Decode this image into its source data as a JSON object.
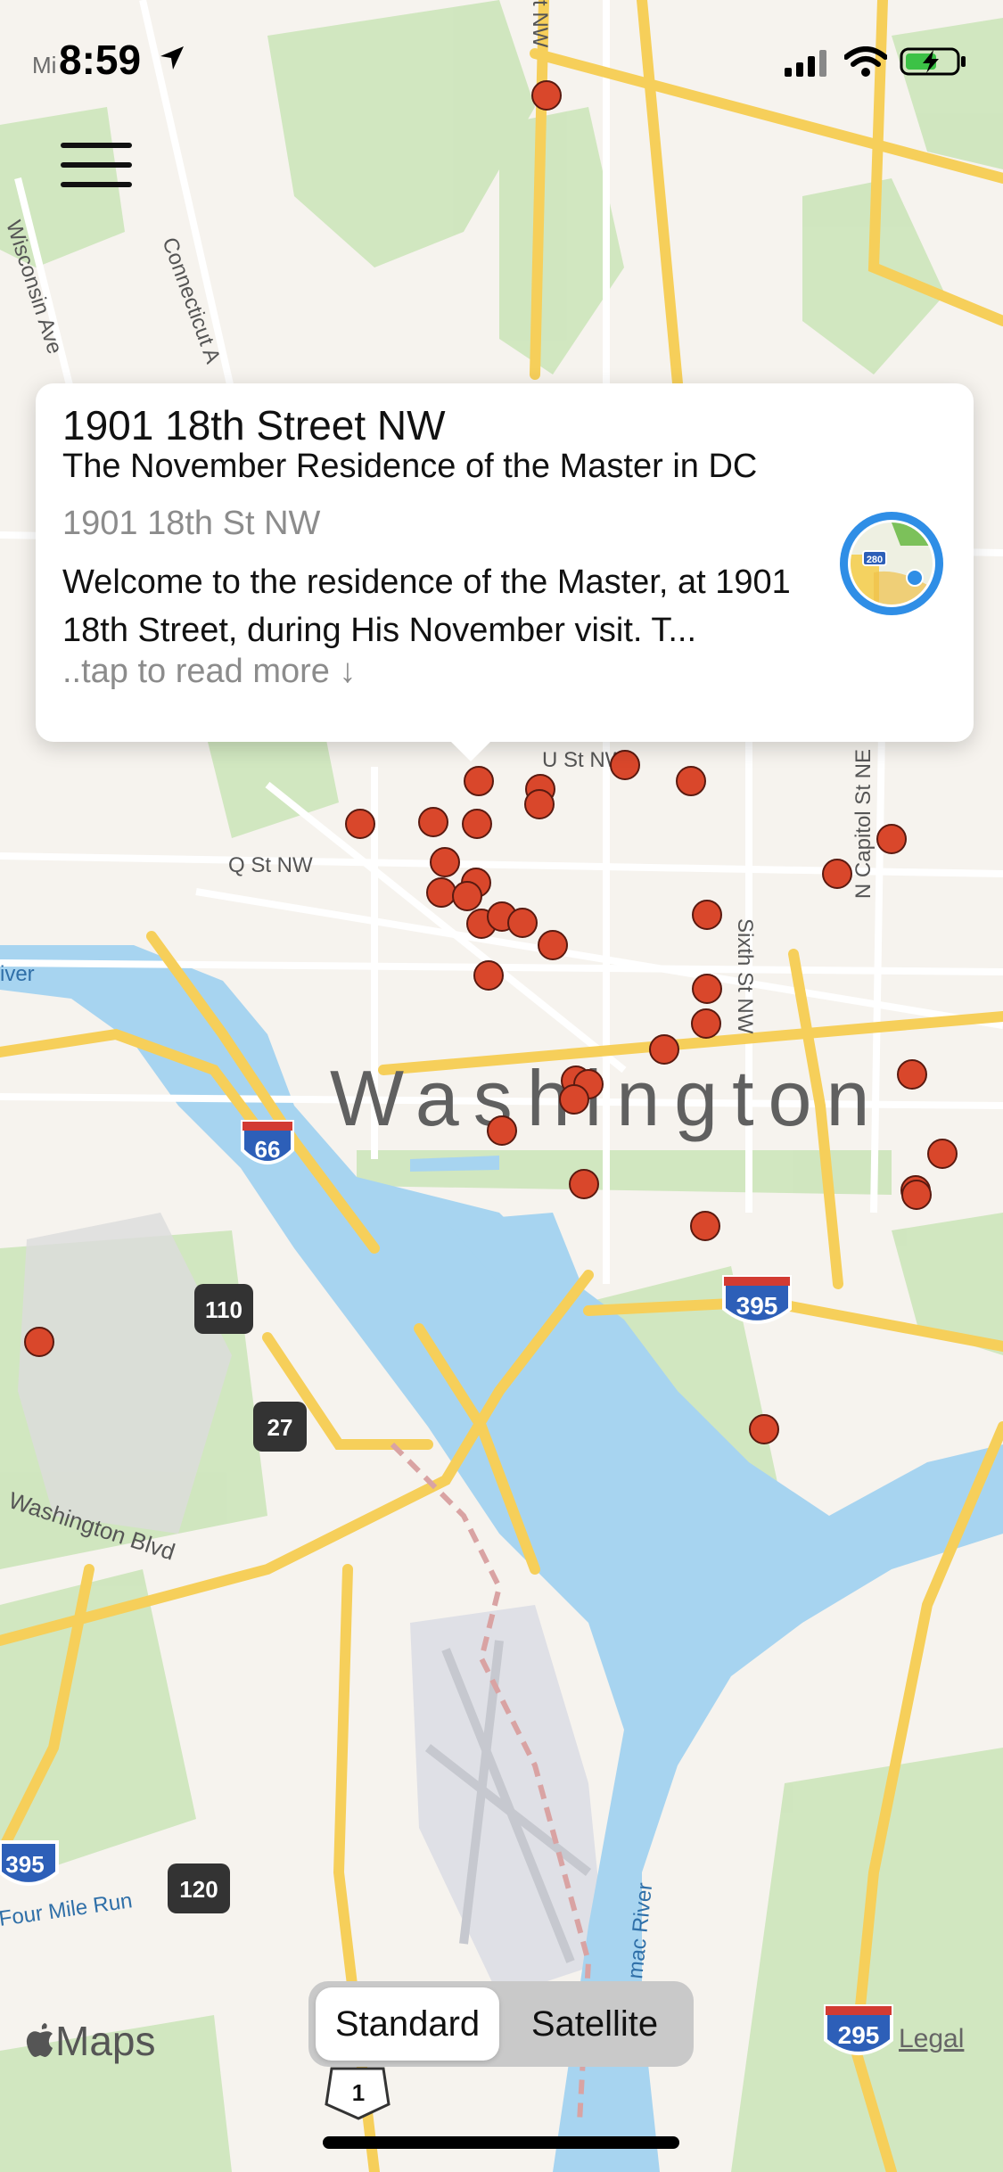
{
  "status_bar": {
    "time": "8:59",
    "street_behind": "Mi",
    "location_icon": "location-arrow-icon",
    "icons": [
      "cellular-signal-icon",
      "wifi-icon",
      "battery-charging-icon"
    ]
  },
  "menu": {
    "icon": "hamburger-menu-icon"
  },
  "map": {
    "city_label": "Washington",
    "streets": [
      "Wisconsin Ave",
      "Connecticut A",
      "U St NW",
      "Q St NW",
      "Sixth St NW",
      "N Capitol St NE",
      "Washington Blvd",
      "Four Mile Run",
      "iver",
      "mac River",
      "t NW"
    ],
    "shields": [
      "66",
      "110",
      "27",
      "395",
      "395",
      "120",
      "295",
      "1",
      "280"
    ],
    "pin_color": "#d9472b",
    "pin_count": 42
  },
  "callout": {
    "title": "1901 18th Street NW",
    "subtitle": "The November Residence of the Master in DC",
    "address": "1901 18th St NW",
    "description": "Welcome to the residence of the Master, at 1901 18th Street, during His November visit. T...",
    "read_more": "..tap to read more ↓",
    "maps_icon": "apple-maps-app-icon"
  },
  "map_type": {
    "options": [
      "Standard",
      "Satellite"
    ],
    "selected": "Standard"
  },
  "footer": {
    "brand": "Maps",
    "legal": "Legal"
  }
}
